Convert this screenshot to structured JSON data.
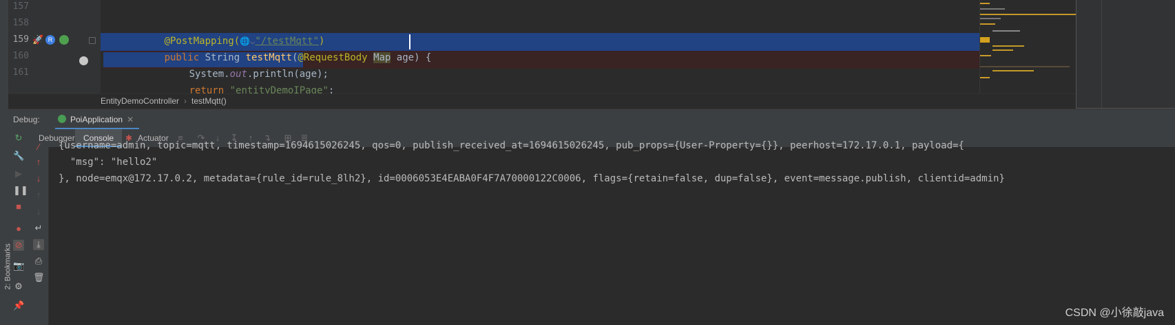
{
  "editor": {
    "lines": [
      {
        "num": "157"
      },
      {
        "num": "158",
        "annotation": "@PostMapping(",
        "path": "\"/testMqtt\"",
        "close": ")"
      },
      {
        "num": "159",
        "kw": "public",
        "type": " String ",
        "method": "testMqtt",
        "open": "(",
        "param_ann": "@RequestBody",
        "param_type": "Map",
        "rest": " age) {"
      },
      {
        "num": "160",
        "prefix": "System.",
        "field": "out",
        "suffix": ".println(age);"
      },
      {
        "num": "161",
        "kw": "return",
        "string": "\"entityDemoIPage\"",
        "end": ";"
      }
    ],
    "gutter_icons": {
      "run": "rocket-icon",
      "r_badge": "R",
      "spring": "spring-bean-icon"
    },
    "breadcrumbs": [
      "EntityDemoController",
      "testMqtt()"
    ]
  },
  "debug": {
    "label": "Debug:",
    "session_tab": "PoiApplication",
    "close_glyph": "✕",
    "tabs": [
      "Debugger",
      "Console",
      "Actuator"
    ],
    "active_tab": "Console"
  },
  "console": {
    "lines": [
      "{username=admin, topic=mqtt, timestamp=1694615026245, qos=0, publish_received_at=1694615026245, pub_props={User-Property={}}, peerhost=172.17.0.1, payload={",
      "  \"msg\": \"hello2\"",
      "}, node=emqx@172.17.0.2, metadata={rule_id=rule_8lh2}, id=0006053E4EABA0F4F7A70000122C0006, flags={retain=false, dup=false}, event=message.publish, clientid=admin}"
    ]
  },
  "sidebar": {
    "bookmarks_label": "2: Bookmarks"
  },
  "watermark": "CSDN @小徐敲java",
  "colors": {
    "accent": "#4a88c7",
    "selection": "#214283",
    "keyword": "#cc7832",
    "annotation": "#bbb529",
    "string": "#6a8759"
  }
}
